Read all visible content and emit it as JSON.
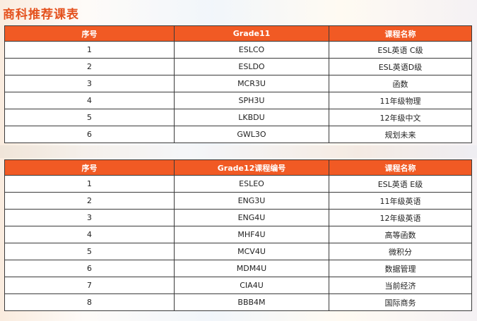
{
  "page": {
    "title": "商科推荐课表"
  },
  "table1": {
    "headers": [
      "序号",
      "Grade11",
      "课程名称"
    ],
    "rows": [
      [
        "1",
        "ESLCO",
        "ESL英语 C级"
      ],
      [
        "2",
        "ESLDO",
        "ESL英语D级"
      ],
      [
        "3",
        "MCR3U",
        "函数"
      ],
      [
        "4",
        "SPH3U",
        "11年级物理"
      ],
      [
        "5",
        "LKBDU",
        "12年级中文"
      ],
      [
        "6",
        "GWL3O",
        "规划未来"
      ]
    ]
  },
  "table2": {
    "headers": [
      "序号",
      "Grade12课程编号",
      "课程名称"
    ],
    "rows": [
      [
        "1",
        "ESLEO",
        "ESL英语 E级"
      ],
      [
        "2",
        "ENG3U",
        "11年级英语"
      ],
      [
        "3",
        "ENG4U",
        "12年级英语"
      ],
      [
        "4",
        "MHF4U",
        "高等函数"
      ],
      [
        "5",
        "MCV4U",
        "微积分"
      ],
      [
        "6",
        "MDM4U",
        "数据管理"
      ],
      [
        "7",
        "CIA4U",
        "当前经济"
      ],
      [
        "8",
        "BBB4M",
        "国际商务"
      ]
    ]
  },
  "colors": {
    "title": "#e4511e",
    "header_bg": "#f15a24",
    "header_text": "#ffffff"
  }
}
